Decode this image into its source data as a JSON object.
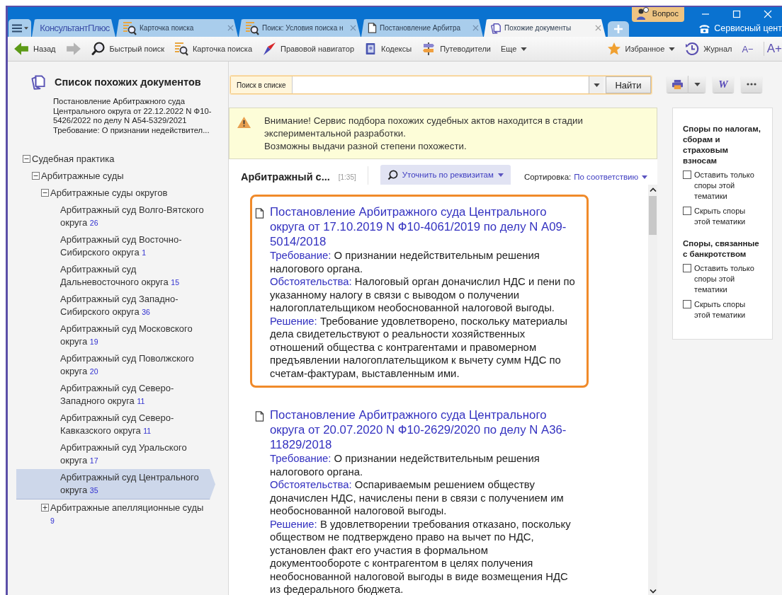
{
  "window": {
    "menu_button": {
      "kind": "menu"
    },
    "tabs": [
      {
        "kind": "logo",
        "label": "КонсультантПлюс",
        "selected": false
      },
      {
        "kind": "search-card",
        "label": "Карточка поиска",
        "selected": false
      },
      {
        "kind": "search-card",
        "label": "Поиск: Условия поиска н",
        "selected": false
      },
      {
        "kind": "document",
        "label": "Постановление Арбитра",
        "selected": false
      },
      {
        "kind": "similar",
        "label": "Похожие документы",
        "selected": true
      }
    ],
    "question_button": "Вопрос",
    "service_center": "Сервисный цент"
  },
  "toolbar": {
    "left": [
      {
        "kind": "back",
        "label": "Назад",
        "disabled": false
      },
      {
        "kind": "forward",
        "disabled": true
      },
      {
        "kind": "quick-search",
        "label": "Быстрый поиск",
        "disabled": false
      },
      {
        "kind": "search-card",
        "label": "Карточка поиска",
        "disabled": false
      },
      {
        "kind": "navigator",
        "label": "Правовой навигатор",
        "disabled": false
      },
      {
        "kind": "codes",
        "label": "Кодексы",
        "disabled": false
      },
      {
        "kind": "guides",
        "label": "Путеводители",
        "disabled": false
      },
      {
        "kind": "more",
        "label": "Еще",
        "disabled": false
      }
    ],
    "right": [
      {
        "kind": "favorites",
        "label": "Избранное",
        "disabled": false
      },
      {
        "kind": "history",
        "label": "Журнал",
        "disabled": false
      },
      {
        "kind": "font",
        "label": "A−",
        "disabled": false
      },
      {
        "kind": "font-large",
        "label": "A+",
        "disabled": false
      }
    ]
  },
  "sidebar": {
    "title": "Список похожих документов",
    "source_document": "Постановление Арбитражного суда Центрального округа от 22.12.2022 N Ф10-5426/2022 по делу N А54-5329/2021",
    "source_requirement": "Требование: О признании недействител...",
    "tree": [
      {
        "label": "Судебная практика",
        "expanded": true,
        "selected": false,
        "children": [
          {
            "label": "Арбитражные суды",
            "expanded": true,
            "selected": false,
            "children": [
              {
                "label": "Арбитражные суды округов",
                "expanded": true,
                "selected": false,
                "children": [
                  {
                    "label": "Арбитражный суд Волго-Вятского округа",
                    "count": "26",
                    "selected": false
                  },
                  {
                    "label": "Арбитражный суд Восточно-Сибирского округа",
                    "count": "1",
                    "selected": false
                  },
                  {
                    "label": "Арбитражный суд Дальневосточного округа",
                    "count": "15",
                    "selected": false
                  },
                  {
                    "label": "Арбитражный суд Западно-Сибирского округа",
                    "count": "36",
                    "selected": false
                  },
                  {
                    "label": "Арбитражный суд Московского округа",
                    "count": "19",
                    "selected": false
                  },
                  {
                    "label": "Арбитражный суд Поволжского округа",
                    "count": "20",
                    "selected": false
                  },
                  {
                    "label": "Арбитражный суд Северо-Западного округа",
                    "count": "11",
                    "selected": false
                  },
                  {
                    "label": "Арбитражный суд Северо-Кавказского округа",
                    "count": "11",
                    "selected": false
                  },
                  {
                    "label": "Арбитражный суд Уральского округа",
                    "count": "17",
                    "selected": false
                  },
                  {
                    "label": "Арбитражный суд Центрального округа",
                    "count": "35",
                    "selected": true
                  }
                ]
              },
              {
                "label": "Арбитражные апелляционные суды",
                "count": "9",
                "expanded": false,
                "selected": false
              }
            ]
          }
        ]
      }
    ]
  },
  "search": {
    "label": "Поиск в списке",
    "button": "Найти"
  },
  "actions": {
    "word_button": "W"
  },
  "notice": {
    "lines": [
      "Внимание! Сервис подбора похожих судебных актов находится в стадии экспериментальной разработки.",
      "Возможны выдачи разной степени похожести."
    ]
  },
  "results": {
    "heading": "Арбитражный с...",
    "range": "[1:35]",
    "refine_button": "Уточнить по реквизитам",
    "sort_label": "Сортировка:",
    "sort_value": "По соответствию",
    "documents": [
      {
        "selected": true,
        "title": "Постановление Арбитражного суда Центрального округа от 17.10.2019 N Ф10-4061/2019 по делу N А09-5014/2018",
        "fields": [
          {
            "label": "Требование:",
            "text": "О признании недействительным решения налогового органа."
          },
          {
            "label": "Обстоятельства:",
            "text": "Налоговый орган доначислил НДС и пени по указанному налогу в связи с выводом о получении налогоплательщиком необоснованной налоговой выгоды."
          },
          {
            "label": "Решение:",
            "text": "Требование удовлетворено, поскольку материалы дела свидетельствуют о реальности хозяйственных отношений общества с контрагентами и правомерном предъявлении налогоплательщиком к вычету сумм НДС по счетам-фактурам, выставленным ими."
          }
        ]
      },
      {
        "selected": false,
        "title": "Постановление Арбитражного суда Центрального округа от 20.07.2020 N Ф10-2629/2020 по делу N А36-11829/2018",
        "fields": [
          {
            "label": "Требование:",
            "text": "О признании недействительным решения налогового органа."
          },
          {
            "label": "Обстоятельства:",
            "text": "Оспариваемым решением обществу доначислен НДС, начислены пени в связи с получением им необоснованной налоговой выгоды."
          },
          {
            "label": "Решение:",
            "text": "В удовлетворении требования отказано, поскольку обществом не подтверждено право на вычет по НДС, установлен факт его участия в формальном документообороте с контрагентом в целях получения необоснованной налоговой выгоды в виде возмещения НДС из федерального бюджета."
          }
        ]
      }
    ]
  },
  "filters": [
    {
      "title": "Споры по налогам, сборам и страховым взносам",
      "options": [
        {
          "label": "Оставить только споры этой тематики",
          "checked": false
        },
        {
          "label": "Скрыть споры этой тематики",
          "checked": false
        }
      ]
    },
    {
      "title": "Споры, связанные с банкротством",
      "options": [
        {
          "label": "Оставить только споры этой тематики",
          "checked": false
        },
        {
          "label": "Скрыть споры этой тематики",
          "checked": false
        }
      ]
    }
  ]
}
